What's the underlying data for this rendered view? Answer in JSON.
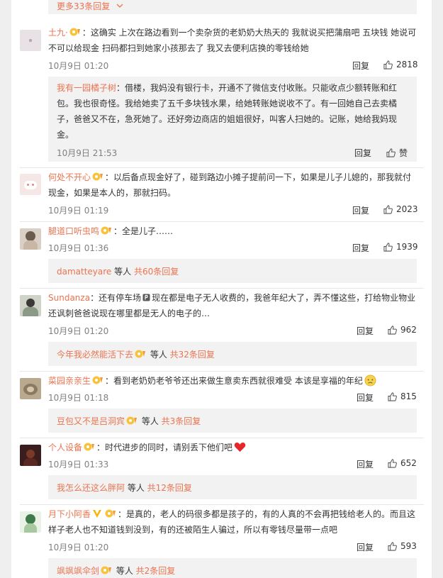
{
  "top_more": {
    "label": "更多33条回复"
  },
  "icons": {
    "thumb": "thumb-up-icon",
    "badge": "vip-badge-icon",
    "chevron": "chevron-down-icon"
  },
  "comments": [
    {
      "user": "土九·",
      "text1": "：这确实 上次在路边看到一个卖杂货的老奶奶大热天的 我就说买把蒲扇吧 五块钱 她说可",
      "text2": "不可以给现金 扫码都扫到她家小孩那去了 我又去便利店换的零钱给她",
      "time": "10月9日 01:20",
      "reply": "回复",
      "likes": "2818",
      "sub": {
        "user": "我有一园橘子树",
        "l1": "：借楼，我妈没有银行卡，开通不了微信支付收账。只能收点少额转账和红",
        "l2": "包。我也很奇怪。我给她卖了五千多块钱水果，给她转账她说收不了。有一回她自己去卖橘",
        "l3": "子，爸爸又不在，急死她了。还好旁边商店的姐姐很好，叫客人扫她的。记账，她给我妈现",
        "l4": "金。",
        "time": "10月9日 21:53",
        "reply": "回复",
        "likes": "赞"
      }
    },
    {
      "user": "何处不开心",
      "text1": "：以后备点现金好了，碰到路边小摊子提前问一下，如果是儿子儿媳的，那我就付",
      "text2": "现金，如果是本人的，那就扫码。",
      "time": "10月9日 01:19",
      "reply": "回复",
      "likes": "2023"
    },
    {
      "user": "腿道口听虫鸣",
      "text1": "：全是儿子……",
      "time": "10月9日 01:36",
      "reply": "回复",
      "likes": "1939",
      "more": {
        "user": "damatteyare",
        "mid": " 等人 ",
        "count": "共60条回复"
      }
    },
    {
      "user": "Sundanza",
      "text1a": "：还有停车场",
      "text1b": "现在都是电子无人收费的，我爸年纪大了，弄不懂这些，打给物业物业",
      "text2": "还讽刺爸爸说现在哪里都是无人的电子的…",
      "time": "10月9日 01:20",
      "reply": "回复",
      "likes": "962",
      "more": {
        "user": "今年我必然能活下去",
        "mid": " 等人 ",
        "count": "共32条回复"
      }
    },
    {
      "user": "菜园亲亲生",
      "text1": "：看到老奶奶老爷爷还出来做生意卖东西就很难受 本该是享福的年纪",
      "time": "10月9日 01:18",
      "reply": "回复",
      "likes": "815",
      "more": {
        "user": "豆包又不是吕洞宾",
        "mid": " 等人 ",
        "count": "共3条回复"
      }
    },
    {
      "user": "个人设备",
      "text1": "：时代进步的同时，请别丢下他们吧",
      "time": "10月9日 01:33",
      "reply": "回复",
      "likes": "652",
      "more": {
        "user": "我怎么还这么胖阿",
        "mid": " 等人 ",
        "count": "共12条回复"
      }
    },
    {
      "user": "月下小阿香",
      "text1": "：是真的，老人的码很多都是孩子的，有的人真的不会再把钱给老人的。而且这",
      "text2": "样子老人也不知道钱到没到，有的还被陌生人骗过，所以有零钱尽量带一点吧",
      "time": "10月9日 01:20",
      "reply": "回复",
      "likes": "593",
      "more": {
        "user": "飒飒飒伞剑",
        "mid": " 等人 ",
        "count": "共2条回复"
      }
    }
  ]
}
